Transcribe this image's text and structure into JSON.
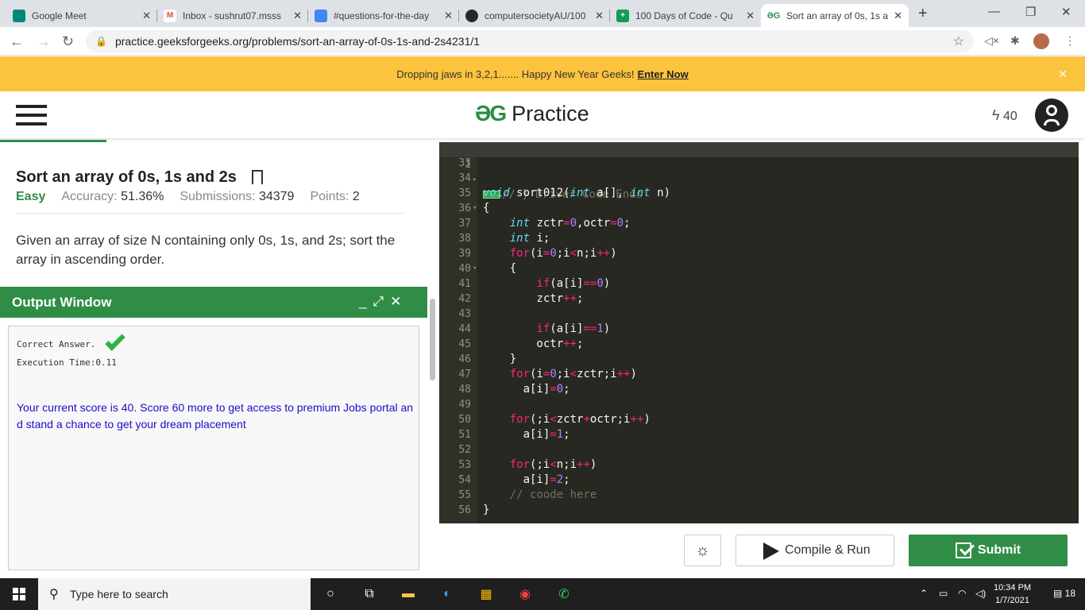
{
  "browser": {
    "tabs": [
      {
        "title": "Google Meet",
        "favicon_color": "#00897b"
      },
      {
        "title": "Inbox - sushrut07.msss",
        "favicon_color": "#ea4335"
      },
      {
        "title": "#questions-for-the-day",
        "favicon_color": "#4285f4"
      },
      {
        "title": "computersocietyAU/100",
        "favicon_color": "#24292e"
      },
      {
        "title": "100 Days of Code - Qu",
        "favicon_color": "#0f9d58"
      },
      {
        "title": "Sort an array of 0s, 1s a",
        "favicon_color": "#2f8d46"
      }
    ],
    "new_tab": "+",
    "url": "practice.geeksforgeeks.org/problems/sort-an-array-of-0s-1s-and-2s4231/1"
  },
  "banner": {
    "text": "Dropping jaws in 3,2,1....... Happy New Year Geeks!",
    "link": "Enter Now"
  },
  "header": {
    "logo": "ƏG",
    "brand": "Practice",
    "score": "40"
  },
  "problem": {
    "title": "Sort an array of 0s, 1s and 2s",
    "difficulty": "Easy",
    "accuracy_label": "Accuracy:",
    "accuracy": "51.36%",
    "submissions_label": "Submissions:",
    "submissions": "34379",
    "points_label": "Points:",
    "points": "2",
    "description": "Given an array of size N containing only 0s, 1s, and 2s; sort the array in ascending order."
  },
  "output": {
    "title": "Output Window",
    "result": "Correct Answer.",
    "exec_time": "Execution Time:0.11",
    "message": "Your current score is 40. Score 60 more to get access to premium Jobs portal and stand a chance to get your dream placement"
  },
  "editor": {
    "first_line": {
      "num": "1",
      "text": "// } Driver Code Ends"
    },
    "lines": [
      {
        "num": "33",
        "html": ""
      },
      {
        "num": "34",
        "html": ""
      },
      {
        "num": "35",
        "html": "<span class='kw'>void</span> sort012(<span class='kw'>int</span> a[], <span class='kw'>int</span> n)"
      },
      {
        "num": "36",
        "html": "{",
        "fold": true
      },
      {
        "num": "37",
        "html": "    <span class='kw'>int</span> zctr<span class='op'>=</span><span class='num'>0</span>,octr<span class='op'>=</span><span class='num'>0</span>;"
      },
      {
        "num": "38",
        "html": "    <span class='kw'>int</span> i;"
      },
      {
        "num": "39",
        "html": "    <span class='op'>for</span>(i<span class='op'>=</span><span class='num'>0</span>;i<span class='op'>&lt;</span>n;i<span class='op'>++</span>)"
      },
      {
        "num": "40",
        "html": "    {",
        "fold": true
      },
      {
        "num": "41",
        "html": "        <span class='op'>if</span>(a[i]<span class='op'>==</span><span class='num'>0</span>)"
      },
      {
        "num": "42",
        "html": "        zctr<span class='op'>++</span>;"
      },
      {
        "num": "43",
        "html": ""
      },
      {
        "num": "44",
        "html": "        <span class='op'>if</span>(a[i]<span class='op'>==</span><span class='num'>1</span>)"
      },
      {
        "num": "45",
        "html": "        octr<span class='op'>++</span>;"
      },
      {
        "num": "46",
        "html": "    }"
      },
      {
        "num": "47",
        "html": "    <span class='op'>for</span>(i<span class='op'>=</span><span class='num'>0</span>;i<span class='op'>&lt;</span>zctr;i<span class='op'>++</span>)"
      },
      {
        "num": "48",
        "html": "      a[i]<span class='op'>=</span><span class='num'>0</span>;"
      },
      {
        "num": "49",
        "html": ""
      },
      {
        "num": "50",
        "html": "    <span class='op'>for</span>(;i<span class='op'>&lt;</span>zctr<span class='op'>+</span>octr;i<span class='op'>++</span>)"
      },
      {
        "num": "51",
        "html": "      a[i]<span class='op'>=</span><span class='num'>1</span>;"
      },
      {
        "num": "52",
        "html": ""
      },
      {
        "num": "53",
        "html": "    <span class='op'>for</span>(;i<span class='op'>&lt;</span>n;i<span class='op'>++</span>)"
      },
      {
        "num": "54",
        "html": "      a[i]<span class='op'>=</span><span class='num'>2</span>;"
      },
      {
        "num": "55",
        "html": "    <span class='cm'>// coode here</span>"
      },
      {
        "num": "56",
        "html": "}"
      }
    ]
  },
  "actions": {
    "compile": "Compile & Run",
    "submit": "Submit"
  },
  "taskbar": {
    "search_placeholder": "Type here to search",
    "time": "10:34 PM",
    "date": "1/7/2021",
    "notifications": "18"
  },
  "colors": {
    "gfg_green": "#2f8d46",
    "banner_yellow": "#fcc33e",
    "editor_bg": "#272822"
  }
}
